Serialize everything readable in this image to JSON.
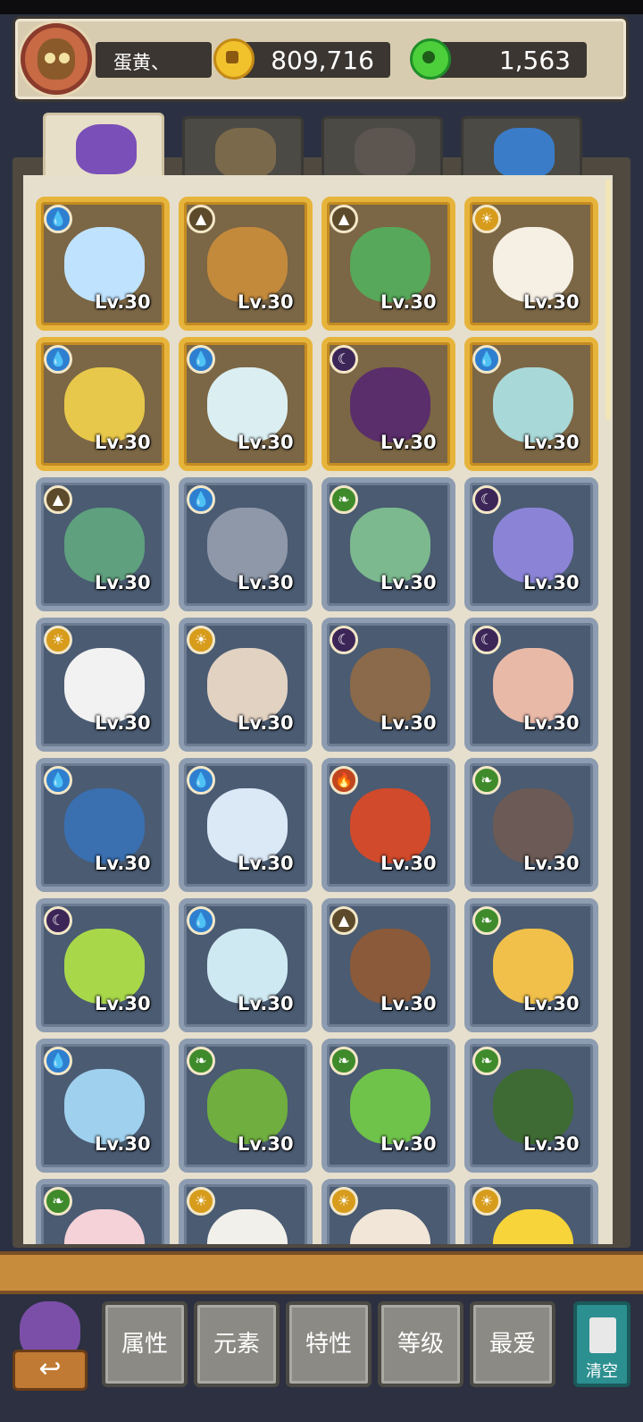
{
  "header": {
    "player_name": "蛋黄、",
    "coins": "809,716",
    "gems": "1,563",
    "avatar_icon": "character-avatar-icon",
    "coin_icon": "coin-icon",
    "gem_icon": "jade-gem-icon"
  },
  "tabs": [
    {
      "name": "monster-tab",
      "active": true,
      "color": "#7b4fb8"
    },
    {
      "name": "item-tab",
      "active": false,
      "color": "#7a6a4b"
    },
    {
      "name": "food-tab",
      "active": false,
      "color": "#5c5550"
    },
    {
      "name": "crystal-tab",
      "active": false,
      "color": "#3b7cc8"
    }
  ],
  "pets": [
    {
      "level": "Lv.30",
      "element": "water",
      "tier": "gold",
      "color": "#bfe3ff"
    },
    {
      "level": "Lv.30",
      "element": "earth",
      "tier": "gold",
      "color": "#c48a3c"
    },
    {
      "level": "Lv.30",
      "element": "earth",
      "tier": "gold",
      "color": "#57a85a"
    },
    {
      "level": "Lv.30",
      "element": "sun",
      "tier": "gold",
      "color": "#f6efe4"
    },
    {
      "level": "Lv.30",
      "element": "water",
      "tier": "gold",
      "color": "#e8c84a"
    },
    {
      "level": "Lv.30",
      "element": "water",
      "tier": "gold",
      "color": "#dbeff2"
    },
    {
      "level": "Lv.30",
      "element": "moon",
      "tier": "gold",
      "color": "#5a2d6b"
    },
    {
      "level": "Lv.30",
      "element": "water",
      "tier": "gold",
      "color": "#a9d8d8"
    },
    {
      "level": "Lv.30",
      "element": "earth",
      "tier": "blue",
      "color": "#5fa07e"
    },
    {
      "level": "Lv.30",
      "element": "water",
      "tier": "blue",
      "color": "#8f98a8"
    },
    {
      "level": "Lv.30",
      "element": "leaf",
      "tier": "blue",
      "color": "#7cb98e"
    },
    {
      "level": "Lv.30",
      "element": "moon",
      "tier": "blue",
      "color": "#8b84d6"
    },
    {
      "level": "Lv.30",
      "element": "sun",
      "tier": "blue",
      "color": "#f2f2f2"
    },
    {
      "level": "Lv.30",
      "element": "sun",
      "tier": "blue",
      "color": "#e2d2c2"
    },
    {
      "level": "Lv.30",
      "element": "moon",
      "tier": "blue",
      "color": "#8a6a4a"
    },
    {
      "level": "Lv.30",
      "element": "moon",
      "tier": "blue",
      "color": "#e9b9a8"
    },
    {
      "level": "Lv.30",
      "element": "water",
      "tier": "blue",
      "color": "#3a6fb0"
    },
    {
      "level": "Lv.30",
      "element": "water",
      "tier": "blue",
      "color": "#dbe8f6"
    },
    {
      "level": "Lv.30",
      "element": "fire",
      "tier": "blue",
      "color": "#d04a2b"
    },
    {
      "level": "Lv.30",
      "element": "leaf",
      "tier": "blue",
      "color": "#6b5a55"
    },
    {
      "level": "Lv.30",
      "element": "moon",
      "tier": "blue",
      "color": "#a8d84a"
    },
    {
      "level": "Lv.30",
      "element": "water",
      "tier": "blue",
      "color": "#cfe9f2"
    },
    {
      "level": "Lv.30",
      "element": "earth",
      "tier": "blue",
      "color": "#8a5a3a"
    },
    {
      "level": "Lv.30",
      "element": "leaf",
      "tier": "blue",
      "color": "#f0c04a"
    },
    {
      "level": "Lv.30",
      "element": "water",
      "tier": "blue",
      "color": "#9fd0ee"
    },
    {
      "level": "Lv.30",
      "element": "leaf",
      "tier": "blue",
      "color": "#6fae3f"
    },
    {
      "level": "Lv.30",
      "element": "leaf",
      "tier": "blue",
      "color": "#6fc24a"
    },
    {
      "level": "Lv.30",
      "element": "leaf",
      "tier": "blue",
      "color": "#3e6a34"
    },
    {
      "level": "",
      "element": "leaf",
      "tier": "blue",
      "color": "#f5d2d8"
    },
    {
      "level": "",
      "element": "sun",
      "tier": "blue",
      "color": "#f2f0ea"
    },
    {
      "level": "",
      "element": "sun",
      "tier": "blue",
      "color": "#f1e6d8"
    },
    {
      "level": "",
      "element": "sun",
      "tier": "blue",
      "color": "#f7d43a"
    }
  ],
  "element_glyphs": {
    "water": "💧",
    "earth": "▲",
    "sun": "☀",
    "moon": "☾",
    "leaf": "❧",
    "fire": "🔥"
  },
  "filters": [
    "属性",
    "元素",
    "特性",
    "等级",
    "最爱"
  ],
  "clear_label": "清空",
  "back_icon": "back-arrow-icon"
}
